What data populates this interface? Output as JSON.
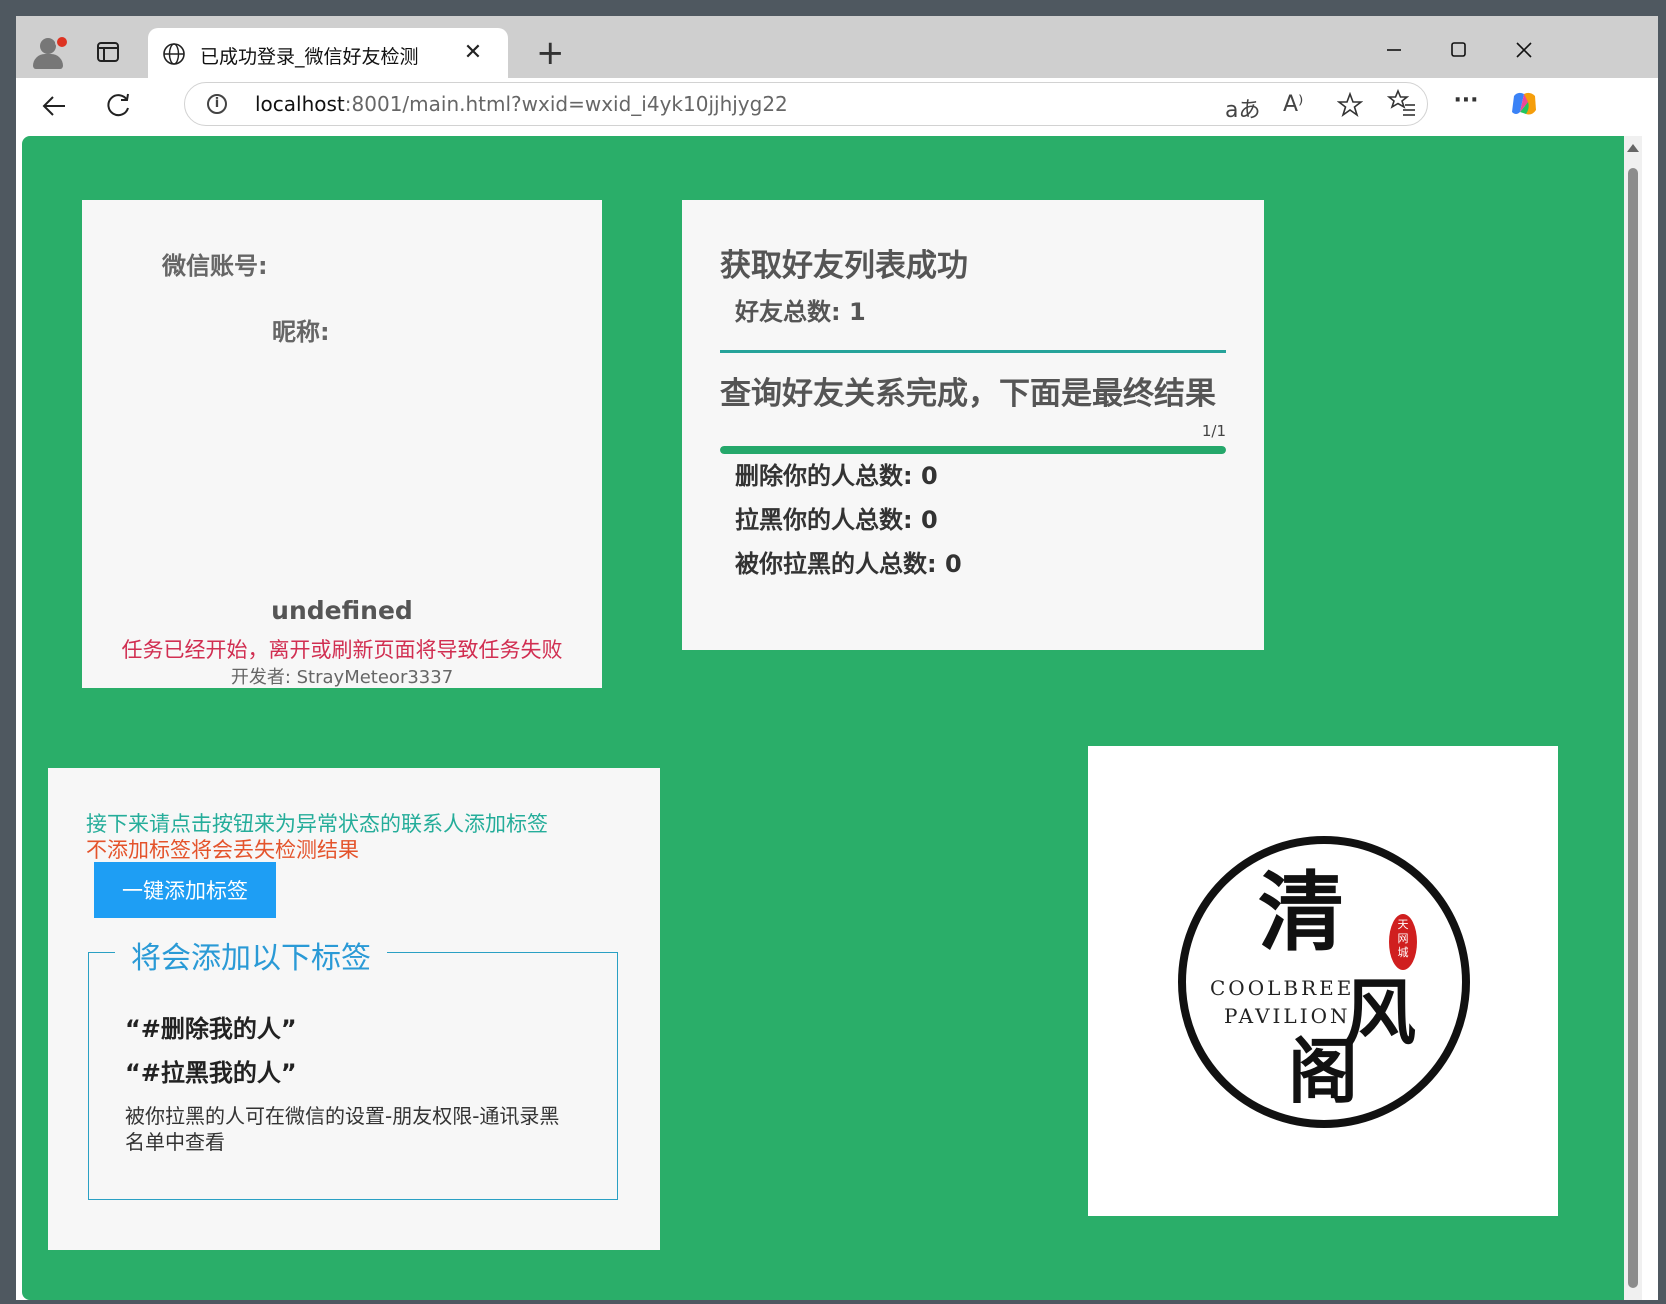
{
  "browser": {
    "tab_title": "已成功登录_微信好友检测",
    "url_host": "localhost",
    "url_rest": ":8001/main.html?wxid=wxid_i4yk10jjhjyg22",
    "translate_label": "aあ",
    "read_aloud_label": "A⁾"
  },
  "account_card": {
    "wechat_id_label": "微信账号:",
    "nickname_label": "昵称:",
    "nickname_value": "undefined",
    "warning": "任务已经开始，离开或刷新页面将导致任务失败",
    "developer": "开发者: StrayMeteor3337"
  },
  "result_card": {
    "heading1": "获取好友列表成功",
    "friend_total": "好友总数: 1",
    "heading2": "查询好友关系完成，下面是最终结果",
    "progress_text": "1/1",
    "progress_value": 1.0,
    "deleted_total": "删除你的人总数: 0",
    "blocked_total": "拉黑你的人总数: 0",
    "blocked_by_you_total": "被你拉黑的人总数: 0"
  },
  "tag_card": {
    "tip1": "接下来请点击按钮来为异常状态的联系人添加标签",
    "tip2": "不添加标签将会丢失检测结果",
    "button_label": "一键添加标签",
    "legend": "将会添加以下标签",
    "tag1": "“#删除我的人”",
    "tag2": "“#拉黑我的人”",
    "note": "被你拉黑的人可在微信的设置-朋友权限-通讯录黑名单中查看"
  },
  "logo": {
    "cn_chars": [
      "清",
      "风",
      "阁"
    ],
    "en_line1": "COOLBREE",
    "en_line2": "PAVILION",
    "seal_text": "天网城"
  },
  "colors": {
    "page_bg": "#2aae69",
    "warning": "#d12e51",
    "tip_teal": "#25ad9a",
    "tip_orange": "#e4532b",
    "button": "#1e9ef4"
  },
  "icons": [
    "profile-icon",
    "tabs-icon",
    "globe-icon",
    "close-icon",
    "plus-icon",
    "minimize-icon",
    "maximize-icon",
    "window-close-icon",
    "back-icon",
    "refresh-icon",
    "info-icon",
    "translate-icon",
    "read-aloud-icon",
    "star-icon",
    "favorites-icon",
    "more-icon",
    "copilot-icon"
  ]
}
